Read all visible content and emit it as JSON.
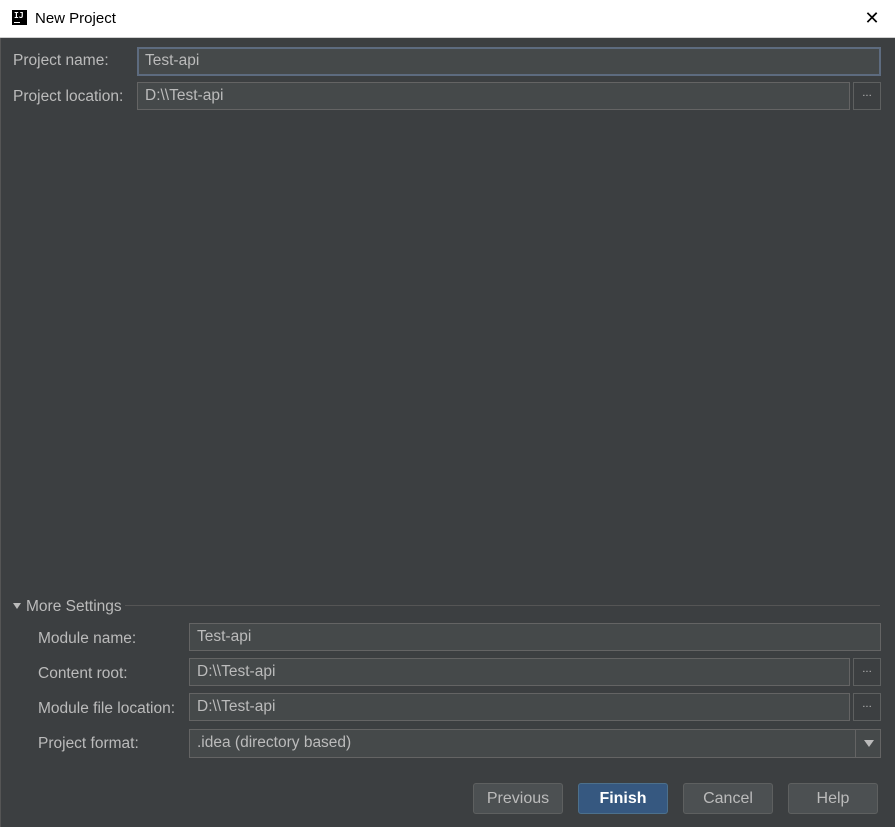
{
  "window": {
    "title": "New Project",
    "app_icon_text": "IJ"
  },
  "project": {
    "name_label": "Project name:",
    "name_value": "Test-api",
    "location_label": "Project location:",
    "location_value": "D:\\\\Test-api",
    "browse_label": "..."
  },
  "more_settings": {
    "title": "More Settings",
    "module_name_label": "Module name:",
    "module_name_value": "Test-api",
    "content_root_label": "Content root:",
    "content_root_value": "D:\\\\Test-api",
    "module_file_label": "Module file location:",
    "module_file_value": "D:\\\\Test-api",
    "format_label": "Project format:",
    "format_value": ".idea (directory based)"
  },
  "buttons": {
    "previous": "Previous",
    "finish": "Finish",
    "cancel": "Cancel",
    "help": "Help"
  },
  "colors": {
    "background": "#3c3f41",
    "field": "#45494a",
    "primary_button": "#365880",
    "text": "#bbbbbb"
  }
}
